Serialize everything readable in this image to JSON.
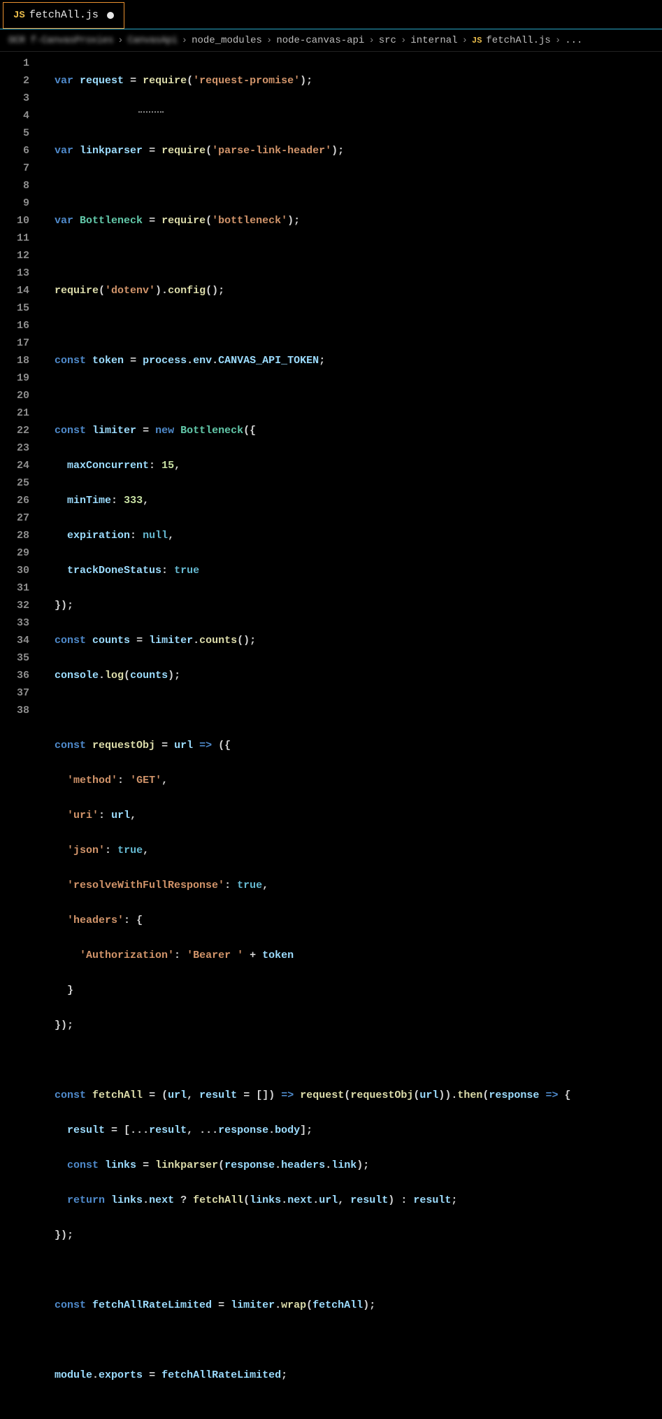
{
  "tab": {
    "icon": "JS",
    "label": "fetchAll.js",
    "dirty": true
  },
  "breadcrumbs": {
    "seg0_blur": "OCR  f-CanvasProxies",
    "seg1_blur": "CanvasApi",
    "seg2": "node_modules",
    "seg3": "node-canvas-api",
    "seg4": "src",
    "seg5": "internal",
    "seg6_icon": "JS",
    "seg6": "fetchAll.js",
    "tail": "..."
  },
  "line_numbers": [
    "1",
    "2",
    "3",
    "4",
    "5",
    "6",
    "7",
    "8",
    "9",
    "10",
    "11",
    "12",
    "13",
    "14",
    "15",
    "16",
    "17",
    "18",
    "19",
    "20",
    "21",
    "22",
    "23",
    "24",
    "25",
    "26",
    "27",
    "28",
    "29",
    "30",
    "31",
    "32",
    "33",
    "34",
    "35",
    "36",
    "37",
    "38"
  ],
  "t": {
    "kw_var": "var",
    "kw_const": "const",
    "kw_new": "new",
    "kw_return": "return",
    "kw_true": "true",
    "kw_null": "null",
    "id_request": "request",
    "id_linkparser": "linkparser",
    "id_Bottleneck": "Bottleneck",
    "id_token": "token",
    "id_limiter": "limiter",
    "id_counts": "counts",
    "id_requestObj": "requestObj",
    "id_fetchAll": "fetchAll",
    "id_fetchAllRateLimited": "fetchAllRateLimited",
    "id_url": "url",
    "id_result": "result",
    "id_response": "response",
    "id_links": "links",
    "id_process": "process",
    "id_env": "env",
    "id_CANVAS_API_TOKEN": "CANVAS_API_TOKEN",
    "id_console": "console",
    "id_module": "module",
    "id_exports": "exports",
    "id_headers": "headers",
    "id_body": "body",
    "id_link": "link",
    "id_next": "next",
    "id_maxConcurrent": "maxConcurrent",
    "id_minTime": "minTime",
    "id_expiration": "expiration",
    "id_trackDoneStatus": "trackDoneStatus",
    "fn_require": "require",
    "fn_config": "config",
    "fn_counts": "counts",
    "fn_log": "log",
    "fn_then": "then",
    "fn_wrap": "wrap",
    "s_request_promise": "'request-promise'",
    "s_parse_link_header": "'parse-link-header'",
    "s_bottleneck": "'bottleneck'",
    "s_dotenv": "'dotenv'",
    "s_method": "'method'",
    "s_GET": "'GET'",
    "s_uri": "'uri'",
    "s_json": "'json'",
    "s_resolveWithFullResponse": "'resolveWithFullResponse'",
    "s_headers": "'headers'",
    "s_Authorization": "'Authorization'",
    "s_Bearer": "'Bearer '",
    "n_15": "15",
    "n_333": "333"
  }
}
